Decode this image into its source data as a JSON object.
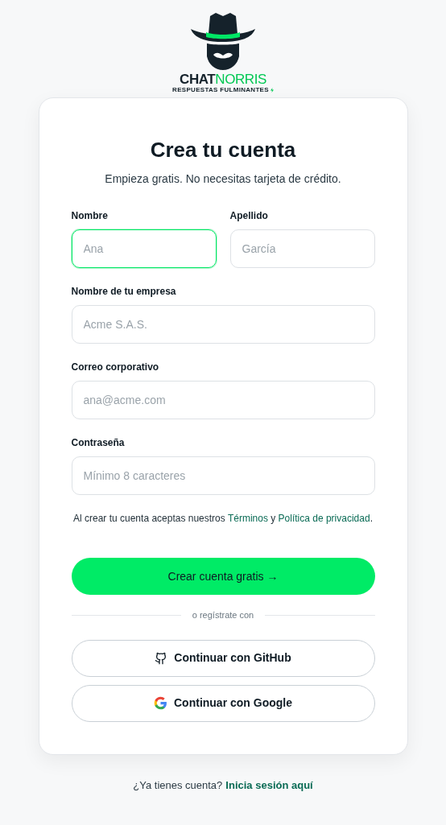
{
  "logo": {
    "brand_first": "CHAT",
    "brand_second": "NORRIS",
    "tagline": "RESPUESTAS FULMINANTES"
  },
  "title": "Crea tu cuenta",
  "subtitle": "Empieza gratis. No necesitas tarjeta de crédito.",
  "fields": [
    {
      "label": "Nombre",
      "placeholder": "Ana",
      "focused": true
    },
    {
      "label": "Apellido",
      "placeholder": "García",
      "focused": false
    },
    {
      "label": "Nombre de tu empresa",
      "placeholder": "Acme S.A.S.",
      "focused": false
    },
    {
      "label": "Correo corporativo",
      "placeholder": "ana@acme.com",
      "focused": false
    },
    {
      "label": "Contraseña",
      "placeholder": "Mínimo 8 caracteres",
      "focused": false
    }
  ],
  "terms": {
    "before": "Al crear tu cuenta aceptas nuestros ",
    "terms_link": "Términos",
    "joiner": " y ",
    "privacy_link": "Política de privacidad",
    "after": "."
  },
  "submit": "Crear cuenta gratis →",
  "divider": "o regístrate con",
  "social": [
    {
      "kind": "github",
      "label": "Continuar con GitHub"
    },
    {
      "kind": "google",
      "label": "Continuar con Google"
    }
  ],
  "footer": {
    "question": "¿Ya tienes cuenta?",
    "link": "Inicia sesión aquí"
  }
}
